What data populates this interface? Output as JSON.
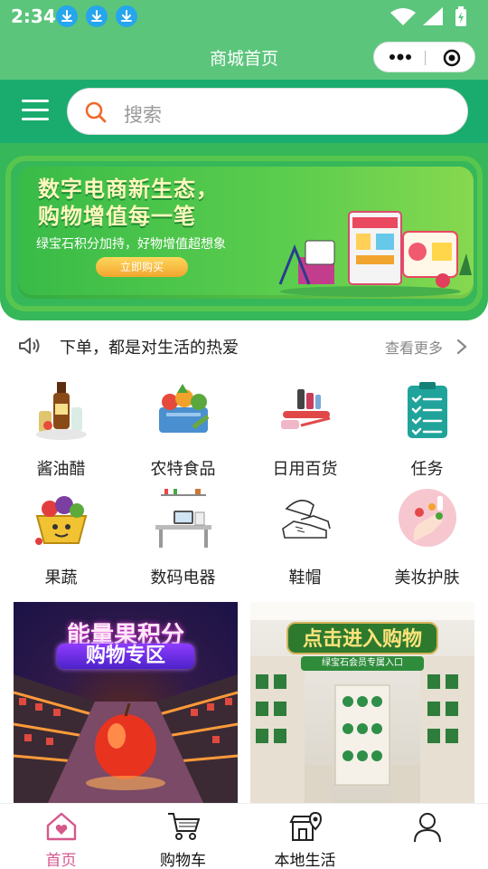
{
  "status_bar": {
    "time": "2:34",
    "download_icons": [
      "download-icon",
      "download-icon",
      "download-icon"
    ],
    "system_icons": [
      "wifi-icon",
      "signal-icon",
      "battery-charging-icon"
    ]
  },
  "title_bar": {
    "title": "商城首页",
    "capsule": {
      "more_icon": "more-dots-icon",
      "close_icon": "target-close-icon"
    }
  },
  "search": {
    "menu_icon": "hamburger-menu-icon",
    "placeholder": "搜索"
  },
  "banner": {
    "headline_line1": "数字电商新生态，",
    "headline_line2": "购物增值每一笔",
    "subtitle": "绿宝石积分加持，好物增值超想象",
    "button_label": "立即购买"
  },
  "notice": {
    "icon": "speaker-icon",
    "text": "下单，都是对生活的热爱",
    "more_label": "查看更多"
  },
  "categories": [
    {
      "label": "酱油醋",
      "icon": "condiments-icon"
    },
    {
      "label": "农特食品",
      "icon": "farm-produce-icon"
    },
    {
      "label": "日用百货",
      "icon": "daily-goods-icon"
    },
    {
      "label": "任务",
      "icon": "task-clipboard-icon"
    },
    {
      "label": "果蔬",
      "icon": "fruit-basket-icon"
    },
    {
      "label": "数码电器",
      "icon": "electronics-desk-icon"
    },
    {
      "label": "鞋帽",
      "icon": "shoes-hat-icon"
    },
    {
      "label": "美妆护肤",
      "icon": "cosmetics-icon"
    }
  ],
  "promos": [
    {
      "title": "能量果积分",
      "subtitle": "购物专区"
    },
    {
      "title": "点击进入购物",
      "subtitle": "绿宝石会员专属入口"
    }
  ],
  "tabs": [
    {
      "label": "首页",
      "icon": "home-heart-icon",
      "active": true
    },
    {
      "label": "购物车",
      "icon": "shopping-cart-icon",
      "active": false
    },
    {
      "label": "本地生活",
      "icon": "local-store-icon",
      "active": false
    },
    {
      "label": "",
      "icon": "user-profile-icon",
      "active": false
    }
  ],
  "colors": {
    "status_green": "#5cc57c",
    "search_green": "#1aac6e",
    "tab_active": "#d6578c",
    "download_blue": "#26a6ec"
  }
}
